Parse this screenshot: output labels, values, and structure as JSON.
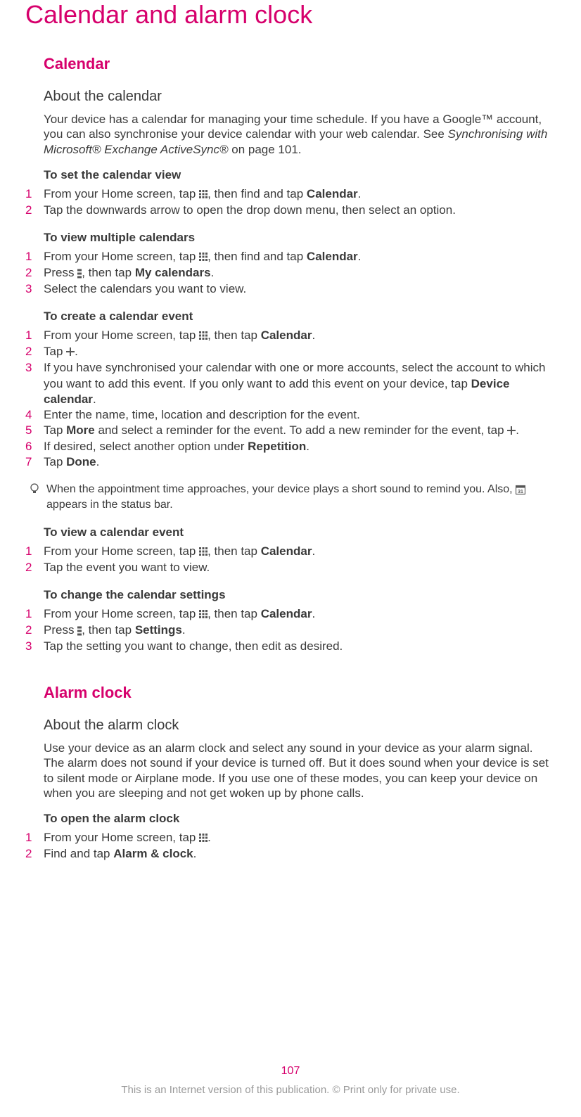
{
  "page_title": "Calendar and alarm clock",
  "page_number": "107",
  "footer": "This is an Internet version of this publication. © Print only for private use.",
  "sections": {
    "calendar": {
      "heading": "Calendar",
      "about": {
        "heading": "About the calendar",
        "body_pre": "Your device has a calendar for managing your time schedule. If you have a Google™ account, you can also synchronise your device calendar with your web calendar. See ",
        "body_ref": "Synchronising with Microsoft® Exchange ActiveSync®",
        "body_post": " on page 101."
      },
      "set_view": {
        "heading": "To set the calendar view",
        "step1a": "From your Home screen, tap ",
        "step1b": ", then find and tap ",
        "step1c": "Calendar",
        "step1d": ".",
        "step2": "Tap the downwards arrow to open the drop down menu, then select an option."
      },
      "view_multiple": {
        "heading": "To view multiple calendars",
        "step1a": "From your Home screen, tap ",
        "step1b": ", then find and tap ",
        "step1c": "Calendar",
        "step1d": ".",
        "step2a": "Press ",
        "step2b": ", then tap ",
        "step2c": "My calendars",
        "step2d": ".",
        "step3": "Select the calendars you want to view."
      },
      "create_event": {
        "heading": "To create a calendar event",
        "step1a": "From your Home screen, tap ",
        "step1b": ", then tap ",
        "step1c": "Calendar",
        "step1d": ".",
        "step2a": "Tap ",
        "step2b": ".",
        "step3a": "If you have synchronised your calendar with one or more accounts, select the account to which you want to add this event. If you only want to add this event on your device, tap ",
        "step3b": "Device calendar",
        "step3c": ".",
        "step4": "Enter the name, time, location and description for the event.",
        "step5a": "Tap ",
        "step5b": "More",
        "step5c": " and select a reminder for the event. To add a new reminder for the event, tap ",
        "step5d": ".",
        "step6a": "If desired, select another option under ",
        "step6b": "Repetition",
        "step6c": ".",
        "step7a": "Tap ",
        "step7b": "Done",
        "step7c": "."
      },
      "tip": {
        "text_a": "When the appointment time approaches, your device plays a short sound to remind you. Also, ",
        "text_b": " appears in the status bar."
      },
      "view_event": {
        "heading": "To view a calendar event",
        "step1a": "From your Home screen, tap ",
        "step1b": ", then tap ",
        "step1c": "Calendar",
        "step1d": ".",
        "step2": "Tap the event you want to view."
      },
      "change_settings": {
        "heading": "To change the calendar settings",
        "step1a": "From your Home screen, tap ",
        "step1b": ", then tap ",
        "step1c": "Calendar",
        "step1d": ".",
        "step2a": "Press ",
        "step2b": ", then tap ",
        "step2c": "Settings",
        "step2d": ".",
        "step3": "Tap the setting you want to change, then edit as desired."
      }
    },
    "alarm": {
      "heading": "Alarm clock",
      "about": {
        "heading": "About the alarm clock",
        "body": "Use your device as an alarm clock and select any sound in your device as your alarm signal. The alarm does not sound if your device is turned off. But it does sound when your device is set to silent mode or Airplane mode. If you use one of these modes, you can keep your device on when you are sleeping and not get woken up by phone calls."
      },
      "open": {
        "heading": "To open the alarm clock",
        "step1a": "From your Home screen, tap ",
        "step1b": ".",
        "step2a": "Find and tap ",
        "step2b": "Alarm & clock",
        "step2c": "."
      }
    }
  }
}
